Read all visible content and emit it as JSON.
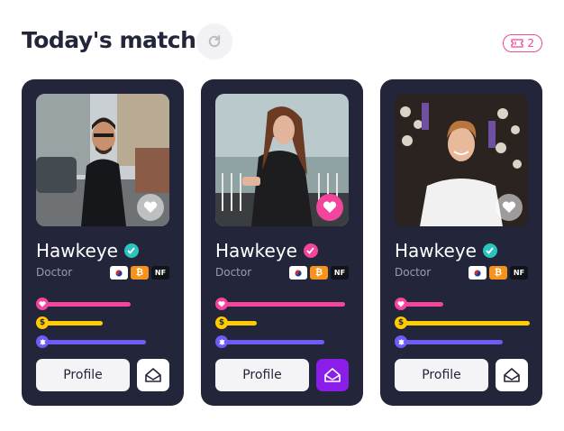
{
  "header": {
    "title": "Today's match",
    "ticket_count": "2"
  },
  "colors": {
    "accent_pink": "#f2459b",
    "accent_purple": "#8a1de8",
    "card_bg": "#23263a",
    "verify_teal": "#2bc4c0",
    "love": "#f2459b",
    "money": "#ffcc00",
    "values": "#6d5cf5"
  },
  "cards": [
    {
      "name": "Hawkeye",
      "job": "Doctor",
      "badge_color": "#2bc4c0",
      "liked": false,
      "messaged": false,
      "chips": [
        "KR",
        "₿",
        "NF"
      ],
      "love": 0.68,
      "money": 0.47,
      "values": 0.82,
      "profile_label": "Profile"
    },
    {
      "name": "Hawkeye",
      "job": "Doctor",
      "badge_color": "#f2459b",
      "liked": true,
      "messaged": true,
      "chips": [
        "KR",
        "₿",
        "NF"
      ],
      "love": 0.96,
      "money": 0.3,
      "values": 0.8,
      "profile_label": "Profile"
    },
    {
      "name": "Hawkeye",
      "job": "Doctor",
      "badge_color": "#2bc4c0",
      "liked": false,
      "messaged": false,
      "chips": [
        "KR",
        "₿",
        "NF"
      ],
      "love": 0.35,
      "money": 1.0,
      "values": 0.8,
      "profile_label": "Profile"
    }
  ]
}
